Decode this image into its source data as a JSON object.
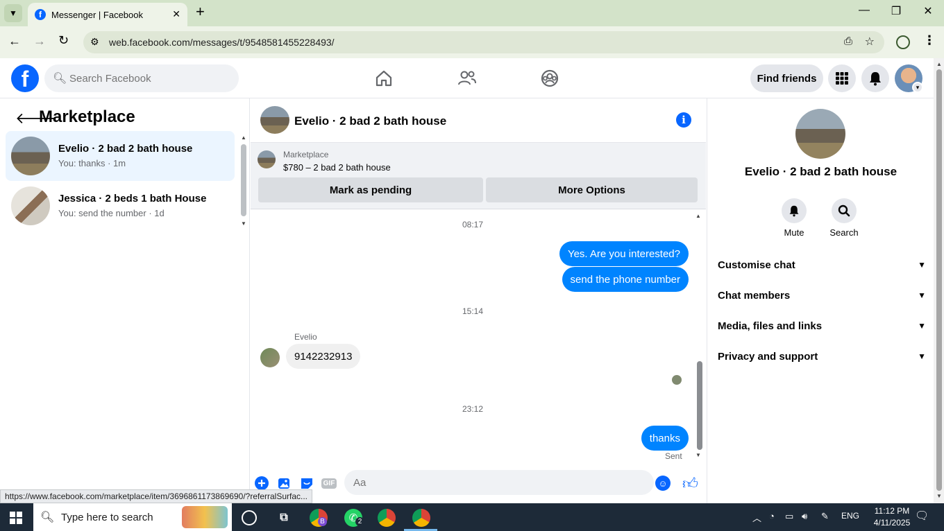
{
  "browser": {
    "tab_title": "Messenger | Facebook",
    "tab_favicon": "f",
    "url": "web.facebook.com/messages/t/9548581455228493/",
    "status_url": "https://www.facebook.com/marketplace/item/3696861173869690/?referralSurfac..."
  },
  "header": {
    "search_placeholder": "Search Facebook",
    "find_friends_label": "Find friends",
    "logo_letter": "f"
  },
  "left_panel": {
    "title": "Marketplace",
    "conversations": [
      {
        "name": "Evelio · 2 bad 2 bath house",
        "preview": "You: thanks · 1m",
        "active": true
      },
      {
        "name": "Jessica · 2 beds 1 bath House",
        "preview": "You: send the number · 1d",
        "active": false
      }
    ]
  },
  "chat": {
    "title": "Evelio · 2 bad 2 bath house",
    "banner_label": "Marketplace",
    "banner_listing": "$780 – 2 bad 2 bath house",
    "mark_pending_label": "Mark as pending",
    "more_options_label": "More Options",
    "timestamps": [
      "08:17",
      "15:14",
      "23:12"
    ],
    "outgoing_1": "Yes. Are you interested?",
    "outgoing_2": "send the phone number",
    "sender_name": "Evelio",
    "incoming_1": "9142232913",
    "outgoing_3": "thanks",
    "sent_status": "Sent",
    "input_placeholder": "Aa",
    "gif_label": "GIF"
  },
  "right_panel": {
    "name": "Evelio · 2 bad 2 bath house",
    "mute_label": "Mute",
    "search_label": "Search",
    "sections": [
      "Customise chat",
      "Chat members",
      "Media, files and links",
      "Privacy and support"
    ]
  },
  "taskbar": {
    "search_placeholder": "Type here to search",
    "whatsapp_badge": "2",
    "chrome_badge": "B",
    "language": "ENG",
    "time": "11:12 PM",
    "date": "4/11/2025"
  },
  "colors": {
    "facebook_blue": "#0866ff",
    "bubble_blue": "#0084ff",
    "chrome_green": "#d3e3c9",
    "taskbar": "#1d2a38"
  }
}
